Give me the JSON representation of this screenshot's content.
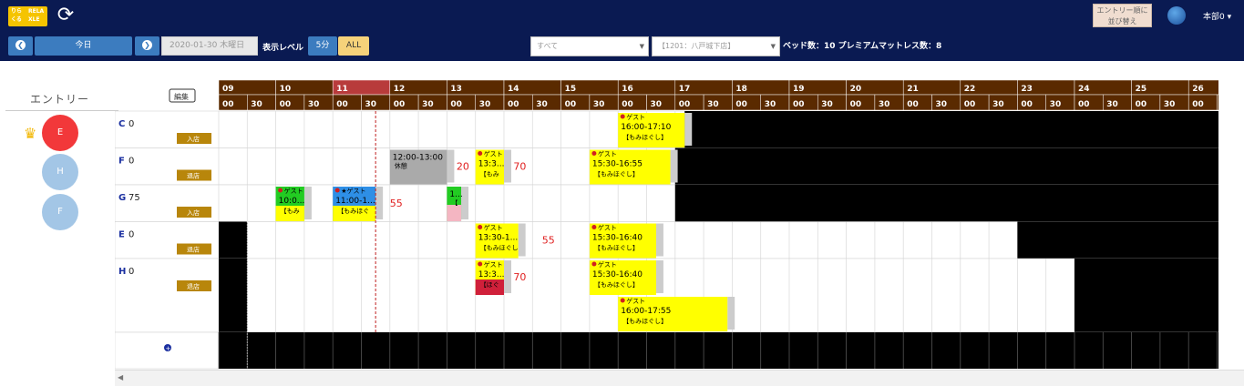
{
  "logo": {
    "l1": "りら",
    "l2": "くる",
    "l3": "RELA",
    "l4": "XLE"
  },
  "header": {
    "entry_order_line1": "エントリー順に",
    "entry_order_line2": "並び替え",
    "user_menu": "本部0 ▾"
  },
  "toolbar": {
    "prev_icon": "❮",
    "today_label": "今日",
    "next_icon": "❯",
    "date_value": "2020-01-30 木曜日",
    "level_label": "表示レベル",
    "level_5min": "5分",
    "level_all": "ALL",
    "select_all": "すべて",
    "select_store": "【1201：八戸城下店】",
    "bed_info": "ベッド数：10 プレミアムマットレス数：8"
  },
  "entry_panel": {
    "title": "エントリー",
    "entries": [
      {
        "label": "E",
        "color": "#f2383a"
      },
      {
        "label": "H",
        "color": "#a3c6e6"
      },
      {
        "label": "F",
        "color": "#a3c6e6"
      }
    ]
  },
  "schedule": {
    "edit_label": "編集",
    "hours": [
      "09",
      "10",
      "11",
      "12",
      "13",
      "14",
      "15",
      "16",
      "17",
      "18",
      "19",
      "20",
      "21",
      "22",
      "23",
      "24",
      "25",
      "26"
    ],
    "minutes": [
      "00",
      "30"
    ],
    "rows": [
      {
        "name": "C",
        "score": "0",
        "status": "入店"
      },
      {
        "name": "F",
        "score": "0",
        "status": "退店"
      },
      {
        "name": "G",
        "score": "75",
        "status": "入店"
      },
      {
        "name": "E",
        "score": "0",
        "status": "退店"
      },
      {
        "name": "H",
        "score": "0",
        "status": "退店"
      }
    ],
    "add_icon": "plus-circle-icon",
    "blocks": [
      {
        "row": 0,
        "start": "16:00",
        "end": "17:10",
        "guest": "ゲスト",
        "time": "16:00-17:10",
        "course": "【もみほぐし】",
        "color": "#ffff00"
      },
      {
        "row": 1,
        "start": "12:00",
        "end": "13:00",
        "guest": "",
        "time": "12:00-13:00",
        "course": "休憩",
        "color": "#aaaaaa"
      },
      {
        "row": 1,
        "start": "13:30",
        "end": "13:60",
        "guest": "ゲスト",
        "time": "13:3...",
        "course": "【もみ",
        "color": "#ffff00"
      },
      {
        "row": 1,
        "start": "15:30",
        "end": "16:55",
        "guest": "ゲスト",
        "time": "15:30-16:55",
        "course": "【もみほぐし】",
        "color": "#ffff00"
      },
      {
        "row": 2,
        "start": "10:00",
        "end": "10:30",
        "guest": "ゲスト",
        "time": "10:0...",
        "course": "【もみ",
        "color": "#22cc22"
      },
      {
        "row": 2,
        "start": "11:00",
        "end": "11:45",
        "guest": "★ゲスト",
        "time": "11:00-1...",
        "course": "【もみほぐ",
        "color": "#2e8fe6"
      },
      {
        "row": 2,
        "start": "13:00",
        "end": "13:15",
        "guest": "",
        "time": "1...",
        "course": "【",
        "color": "#22cc22"
      },
      {
        "row": 3,
        "start": "13:30",
        "end": "14:15",
        "guest": "ゲスト",
        "time": "13:30-1...",
        "course": "【もみほぐし",
        "color": "#ffff00"
      },
      {
        "row": 3,
        "start": "15:30",
        "end": "16:40",
        "guest": "ゲスト",
        "time": "15:30-16:40",
        "course": "【もみほぐし】",
        "color": "#ffff00"
      },
      {
        "row": 4,
        "start": "13:30",
        "end": "14:00",
        "guest": "ゲスト",
        "time": "13:3...",
        "course": "【ほぐ",
        "color": "#ffff00"
      },
      {
        "row": 4,
        "start": "15:30",
        "end": "16:40",
        "guest": "ゲスト",
        "time": "15:30-16:40",
        "course": "【もみほぐし】",
        "color": "#ffff00"
      },
      {
        "row": 4,
        "start": "16:00",
        "end": "17:55",
        "guest": "ゲスト",
        "time": "16:00-17:55",
        "course": "【もみほぐし】",
        "color": "#ffff00"
      }
    ],
    "gap_labels": [
      {
        "row": 1,
        "at": "13:10",
        "text": "20"
      },
      {
        "row": 1,
        "at": "14:10",
        "text": "70"
      },
      {
        "row": 2,
        "at": "12:00",
        "text": "55"
      },
      {
        "row": 3,
        "at": "14:40",
        "text": "55"
      },
      {
        "row": 4,
        "at": "14:10",
        "text": "70"
      }
    ],
    "now_marker": "11:45",
    "colors": {
      "hour_header": "#5a2a00",
      "current_hour": "#b83b3b",
      "blocked": "#000000",
      "gap_text": "#e02020"
    }
  }
}
